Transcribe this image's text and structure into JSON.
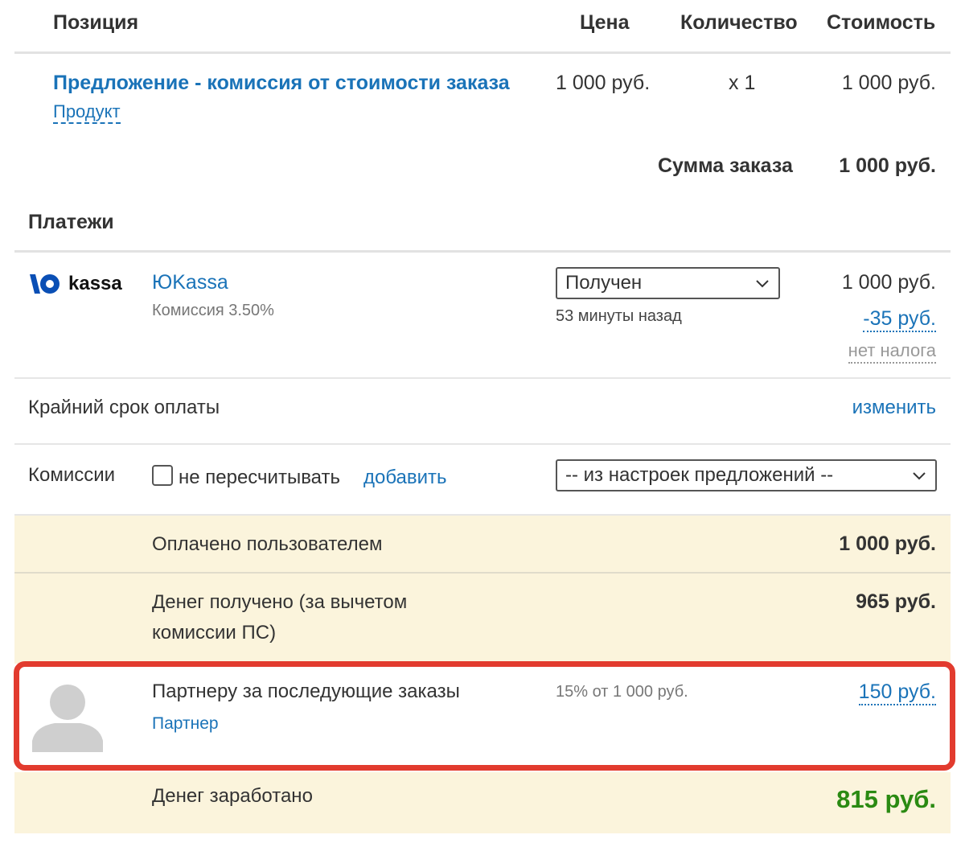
{
  "table_header": {
    "position": "Позиция",
    "price": "Цена",
    "quantity": "Количество",
    "cost": "Стоимость"
  },
  "item": {
    "name": "Предложение - комиссия от стоимости заказа",
    "type": "Продукт",
    "price": "1 000 руб.",
    "quantity": "x 1",
    "cost": "1 000 руб."
  },
  "order_total": {
    "label": "Сумма заказа",
    "value": "1 000 руб."
  },
  "payments": {
    "title": "Платежи",
    "logo_text": "kassa",
    "provider_name": "ЮKassa",
    "commission": "Комиссия 3.50%",
    "status": "Получен",
    "time_ago": "53 минуты назад",
    "amount": "1 000 руб.",
    "fee": "-35 руб.",
    "tax": "нет налога"
  },
  "deadline": {
    "label": "Крайний срок оплаты",
    "action": "изменить"
  },
  "commissions": {
    "label": "Комиссии",
    "checkbox_label": "не пересчитывать",
    "add_link": "добавить",
    "select_value": "-- из настроек предложений --"
  },
  "summary": {
    "paid_label": "Оплачено пользователем",
    "paid_value": "1 000 руб.",
    "received_label_line1": "Денег получено (за вычетом",
    "received_label_line2": "комиссии ПС)",
    "received_value": "965 руб.",
    "earned_label": "Денег заработано",
    "earned_value": "815 руб."
  },
  "partner": {
    "title": "Партнеру за последующие заказы",
    "role": "Партнер",
    "formula": "15% от 1 000 руб.",
    "amount": "150 руб."
  },
  "colors": {
    "link": "#1a73b8",
    "band": "#fbf4dc",
    "highlight": "#e23b2e",
    "earned": "#2a8a12"
  },
  "icons": {
    "logo": "yookassa-logo-icon",
    "avatar": "user-avatar-icon",
    "select": "chevron-down-icon"
  }
}
